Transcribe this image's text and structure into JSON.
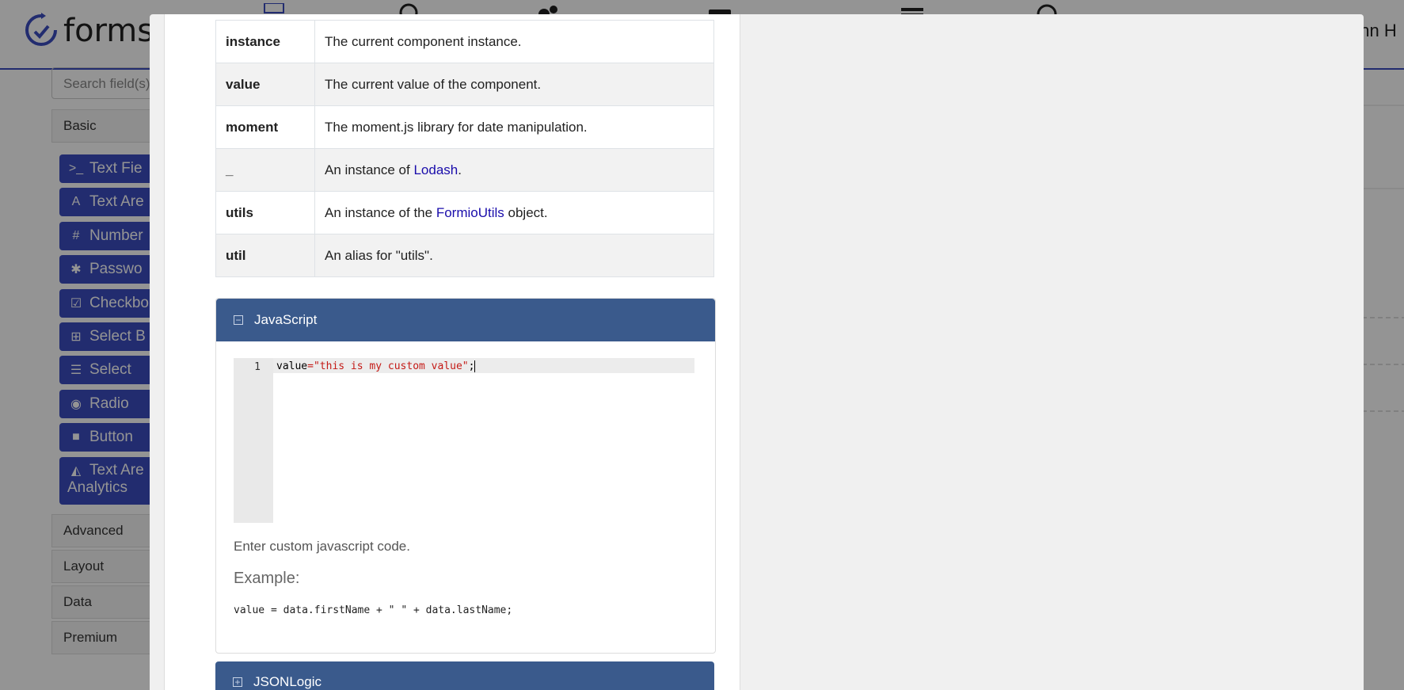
{
  "app": {
    "logo_text": "formsf",
    "user_name": "ohn H",
    "search_placeholder": "Search field(s)"
  },
  "sidebar": {
    "groups": [
      "Basic",
      "Advanced",
      "Layout",
      "Data",
      "Premium"
    ],
    "components": [
      {
        "label": "Text Fie",
        "icon": "terminal-icon",
        "glyph": ">_"
      },
      {
        "label": "Text Are",
        "icon": "font-icon",
        "glyph": "A"
      },
      {
        "label": "Number",
        "icon": "hash-icon",
        "glyph": "#"
      },
      {
        "label": "Passwo",
        "icon": "asterisk-icon",
        "glyph": "✱"
      },
      {
        "label": "Checkbo",
        "icon": "check-square-icon",
        "glyph": "☑"
      },
      {
        "label": "Select B",
        "icon": "plus-square-icon",
        "glyph": "⊞"
      },
      {
        "label": "Select",
        "icon": "list-icon",
        "glyph": "☰"
      },
      {
        "label": "Radio",
        "icon": "dot-circle-icon",
        "glyph": "◉"
      },
      {
        "label": "Button",
        "icon": "stop-icon",
        "glyph": "■"
      },
      {
        "label": "Text Are",
        "label2": "Analytics",
        "icon": "area-chart-icon",
        "glyph": "◭"
      }
    ]
  },
  "variables_table": [
    {
      "key": "instance",
      "desc": "The current component instance."
    },
    {
      "key": "value",
      "desc": "The current value of the component."
    },
    {
      "key": "moment",
      "desc": "The moment.js library for date manipulation."
    },
    {
      "key": "_",
      "desc_pre": "An instance of ",
      "link": "Lodash",
      "desc_post": "."
    },
    {
      "key": "utils",
      "desc_pre": "An instance of the ",
      "link": "FormioUtils",
      "desc_post": " object."
    },
    {
      "key": "util",
      "desc": "An alias for \"utils\"."
    }
  ],
  "javascript_panel": {
    "title": "JavaScript",
    "line_number": "1",
    "code_var": "value",
    "code_eq": "=",
    "code_str": "\"this is my custom value\"",
    "code_end": ";",
    "help_text": "Enter custom javascript code.",
    "example_heading": "Example:",
    "example_code": "value = data.firstName + \" \" + data.lastName;"
  },
  "jsonlogic_panel": {
    "title": "JSONLogic"
  },
  "colors": {
    "brand": "#3b4cc0",
    "panel_header": "#3a5a8c",
    "link": "#1a0dab",
    "code_string": "#c41a16"
  }
}
